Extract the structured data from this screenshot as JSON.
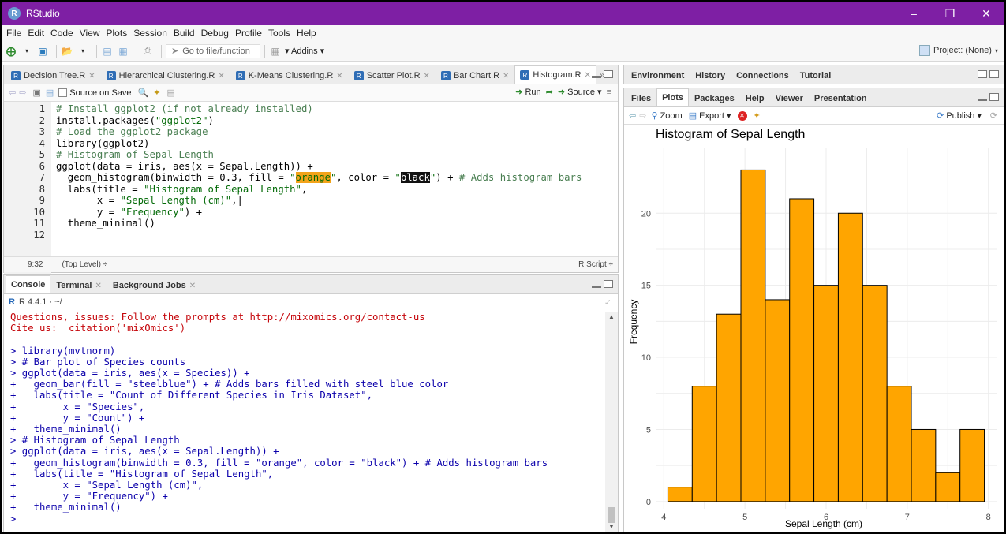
{
  "window": {
    "title": "RStudio",
    "app_icon": "R"
  },
  "menu": [
    "File",
    "Edit",
    "Code",
    "View",
    "Plots",
    "Session",
    "Build",
    "Debug",
    "Profile",
    "Tools",
    "Help"
  ],
  "toolbar": {
    "goto_placeholder": "Go to file/function",
    "addins": "Addins",
    "project": "Project: (None)"
  },
  "editor": {
    "tabs": [
      {
        "label": "Decision Tree.R"
      },
      {
        "label": "Hierarchical Clustering.R"
      },
      {
        "label": "K-Means Clustering.R"
      },
      {
        "label": "Scatter Plot.R"
      },
      {
        "label": "Bar Chart.R"
      },
      {
        "label": "Histogram.R"
      }
    ],
    "source_on_save": "Source on Save",
    "run": "Run",
    "source": "Source",
    "lines": [
      {
        "n": "1",
        "parts": [
          {
            "t": "# Install ggplot2 (if not already installed)",
            "c": "cm"
          }
        ]
      },
      {
        "n": "2",
        "parts": [
          {
            "t": "install.packages(",
            "c": "fn"
          },
          {
            "t": "\"ggplot2\"",
            "c": "str"
          },
          {
            "t": ")",
            "c": "fn"
          }
        ]
      },
      {
        "n": "3",
        "parts": [
          {
            "t": "# Load the ggplot2 package",
            "c": "cm"
          }
        ]
      },
      {
        "n": "4",
        "parts": [
          {
            "t": "library(ggplot2)",
            "c": "fn"
          }
        ]
      },
      {
        "n": "5",
        "parts": [
          {
            "t": "# Histogram of Sepal Length",
            "c": "cm"
          }
        ]
      },
      {
        "n": "6",
        "parts": [
          {
            "t": "ggplot(data = iris, aes(x = Sepal.Length)) +",
            "c": "fn"
          }
        ]
      },
      {
        "n": "7",
        "parts": [
          {
            "t": "  geom_histogram(binwidth = 0.3, fill = ",
            "c": "fn"
          },
          {
            "t": "\"",
            "c": "str"
          },
          {
            "t": "orange",
            "c": "hl-orange"
          },
          {
            "t": "\"",
            "c": "str"
          },
          {
            "t": ", color = ",
            "c": "fn"
          },
          {
            "t": "\"",
            "c": "str"
          },
          {
            "t": "black",
            "c": "hl-black"
          },
          {
            "t": "\"",
            "c": "str"
          },
          {
            "t": ") + ",
            "c": "fn"
          },
          {
            "t": "# Adds histogram bars",
            "c": "cm"
          }
        ]
      },
      {
        "n": "8",
        "parts": [
          {
            "t": "  labs(title = ",
            "c": "fn"
          },
          {
            "t": "\"Histogram of Sepal Length\"",
            "c": "str"
          },
          {
            "t": ",",
            "c": "fn"
          }
        ]
      },
      {
        "n": "9",
        "parts": [
          {
            "t": "       x = ",
            "c": "fn"
          },
          {
            "t": "\"Sepal Length (cm)\"",
            "c": "str"
          },
          {
            "t": ",|",
            "c": "fn"
          }
        ]
      },
      {
        "n": "10",
        "parts": [
          {
            "t": "       y = ",
            "c": "fn"
          },
          {
            "t": "\"Frequency\"",
            "c": "str"
          },
          {
            "t": ") +",
            "c": "fn"
          }
        ]
      },
      {
        "n": "11",
        "parts": [
          {
            "t": "  theme_minimal()",
            "c": "fn"
          }
        ]
      },
      {
        "n": "12",
        "parts": [
          {
            "t": "",
            "c": "fn"
          }
        ]
      }
    ],
    "status_pos": "9:32",
    "status_scope": "(Top Level) ÷",
    "status_type": "R Script ÷"
  },
  "console": {
    "tabs": [
      "Console",
      "Terminal",
      "Background Jobs"
    ],
    "version": "R 4.4.1 · ~/",
    "lines": [
      {
        "t": "Questions, issues: Follow the prompts at http://mixomics.org/contact-us",
        "c": "red"
      },
      {
        "t": "Cite us:  citation('mixOmics')",
        "c": "red"
      },
      {
        "t": "",
        "c": "blue"
      },
      {
        "t": "> library(mvtnorm)",
        "c": "blue"
      },
      {
        "t": "> # Bar plot of Species counts",
        "c": "blue"
      },
      {
        "t": "> ggplot(data = iris, aes(x = Species)) +",
        "c": "blue"
      },
      {
        "t": "+   geom_bar(fill = \"steelblue\") + # Adds bars filled with steel blue color",
        "c": "blue"
      },
      {
        "t": "+   labs(title = \"Count of Different Species in Iris Dataset\",",
        "c": "blue"
      },
      {
        "t": "+        x = \"Species\",",
        "c": "blue"
      },
      {
        "t": "+        y = \"Count\") +",
        "c": "blue"
      },
      {
        "t": "+   theme_minimal()",
        "c": "blue"
      },
      {
        "t": "> # Histogram of Sepal Length",
        "c": "blue"
      },
      {
        "t": "> ggplot(data = iris, aes(x = Sepal.Length)) +",
        "c": "blue"
      },
      {
        "t": "+   geom_histogram(binwidth = 0.3, fill = \"orange\", color = \"black\") + # Adds histogram bars",
        "c": "blue"
      },
      {
        "t": "+   labs(title = \"Histogram of Sepal Length\",",
        "c": "blue"
      },
      {
        "t": "+        x = \"Sepal Length (cm)\",",
        "c": "blue"
      },
      {
        "t": "+        y = \"Frequency\") +",
        "c": "blue"
      },
      {
        "t": "+   theme_minimal()",
        "c": "blue"
      },
      {
        "t": ">",
        "c": "blue"
      }
    ]
  },
  "env_pane": {
    "tabs": [
      "Environment",
      "History",
      "Connections",
      "Tutorial"
    ]
  },
  "files_pane": {
    "tabs": [
      "Files",
      "Plots",
      "Packages",
      "Help",
      "Viewer",
      "Presentation"
    ],
    "zoom": "Zoom",
    "export": "Export",
    "publish": "Publish"
  },
  "chart_data": {
    "type": "bar",
    "title": "Histogram of Sepal Length",
    "xlabel": "Sepal Length (cm)",
    "ylabel": "Frequency",
    "bin_width": 0.3,
    "bins": [
      {
        "left": 4.05,
        "right": 4.35,
        "count": 1
      },
      {
        "left": 4.35,
        "right": 4.65,
        "count": 8
      },
      {
        "left": 4.65,
        "right": 4.95,
        "count": 13
      },
      {
        "left": 4.95,
        "right": 5.25,
        "count": 23
      },
      {
        "left": 5.25,
        "right": 5.55,
        "count": 14
      },
      {
        "left": 5.55,
        "right": 5.85,
        "count": 21
      },
      {
        "left": 5.85,
        "right": 6.15,
        "count": 15
      },
      {
        "left": 6.15,
        "right": 6.45,
        "count": 20
      },
      {
        "left": 6.45,
        "right": 6.75,
        "count": 15
      },
      {
        "left": 6.75,
        "right": 7.05,
        "count": 8
      },
      {
        "left": 7.05,
        "right": 7.35,
        "count": 5
      },
      {
        "left": 7.35,
        "right": 7.65,
        "count": 2
      },
      {
        "left": 7.65,
        "right": 7.95,
        "count": 5
      }
    ],
    "xticks": [
      4,
      5,
      6,
      7,
      8
    ],
    "yticks": [
      0,
      5,
      10,
      15,
      20
    ],
    "xlim": [
      3.9,
      8.1
    ],
    "ylim": [
      -0.5,
      24.5
    ],
    "colors": {
      "fill": "#ffa500",
      "stroke": "#000000"
    },
    "grid": true
  }
}
